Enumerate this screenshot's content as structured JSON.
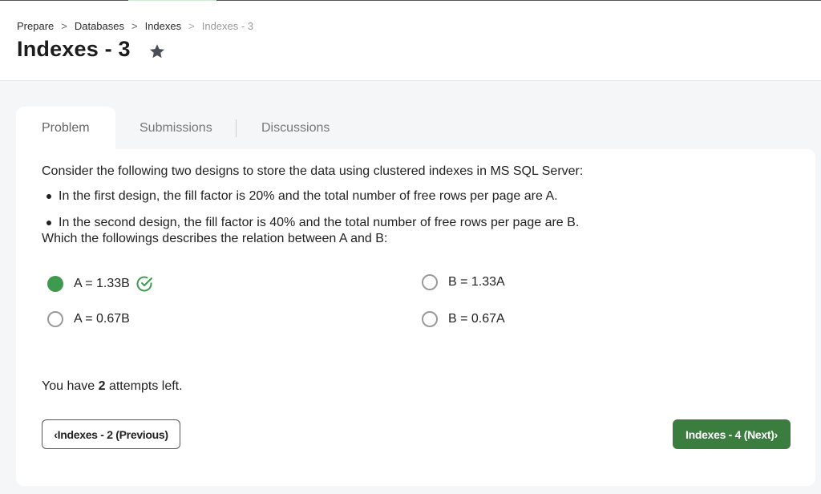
{
  "breadcrumb": {
    "items": [
      "Prepare",
      "Databases",
      "Indexes"
    ],
    "current": "Indexes - 3",
    "separator": ">"
  },
  "page": {
    "title": "Indexes - 3",
    "favorite_icon": "star-icon"
  },
  "tabs": [
    {
      "label": "Problem",
      "active": true
    },
    {
      "label": "Submissions",
      "active": false
    },
    {
      "label": "Discussions",
      "active": false
    }
  ],
  "problem": {
    "question": "Consider the following two designs to store the data using clustered indexes in MS SQL Server:",
    "bullets": [
      "In the first design, the fill factor is 20% and the total number of free rows per page are A.",
      "In the second design, the fill factor is 40% and the total number of free rows per page are B."
    ],
    "prompt": "Which the followings describes the relation between A and B:"
  },
  "options": [
    {
      "label": "A = 1.33B",
      "selected": true,
      "correct": true
    },
    {
      "label": "B = 1.33A",
      "selected": false,
      "correct": false
    },
    {
      "label": "A = 0.67B",
      "selected": false,
      "correct": false
    },
    {
      "label": "B = 0.67A",
      "selected": false,
      "correct": false
    }
  ],
  "attempts": {
    "prefix": "You have",
    "count": "2",
    "suffix": "attempts left."
  },
  "navigation": {
    "prev_label": "Indexes - 2 (Previous)",
    "next_label": "Indexes - 4 (Next)"
  },
  "colors": {
    "accent_green": "#3e9a4f",
    "next_button": "#3a7d3f"
  }
}
